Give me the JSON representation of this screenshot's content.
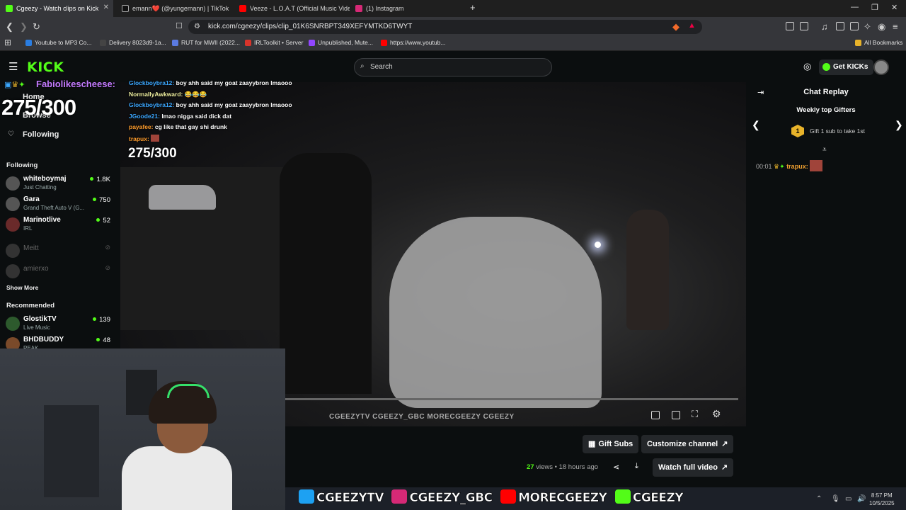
{
  "browser": {
    "tabs": [
      {
        "label": "Cgeezy - Watch clips on Kick",
        "color": "#53fc18",
        "active": true
      },
      {
        "label": "emann❤️ (@yungemann) | TikTok",
        "color": "#222222",
        "active": false
      },
      {
        "label": "Veeze - L.O.A.T (Official Music Video)",
        "color": "#ff0000",
        "active": false
      },
      {
        "label": "(1) Instagram",
        "color": "#d62976",
        "active": false
      }
    ],
    "new_tab": "+",
    "url": "kick.com/cgeezy/clips/clip_01K6SNRBPT349XEFYMTKD6TWYT",
    "bookmarks": [
      {
        "label": "Youtube to MP3 Co...",
        "color": "#2a7de1"
      },
      {
        "label": "Delivery 8023d9-1a...",
        "color": "#444444"
      },
      {
        "label": "RUT for MWII (2022...",
        "color": "#5a7ae0"
      },
      {
        "label": "IRLToolkit • Server",
        "color": "#d9342b"
      },
      {
        "label": "Unpublished, Mute...",
        "color": "#9146ff"
      },
      {
        "label": "https://www.youtub...",
        "color": "#ff0000"
      }
    ],
    "all_bookmarks": "All Bookmarks"
  },
  "kick": {
    "logo": "KICK",
    "search_placeholder": "Search",
    "get_kicks": "Get KICKs"
  },
  "sidebar": {
    "nav": [
      "Home",
      "Browse",
      "Following"
    ],
    "following_title": "Following",
    "following": [
      {
        "name": "whiteboymaj",
        "game": "Just Chatting",
        "viewers": "1.8K",
        "online": true
      },
      {
        "name": "Gara",
        "game": "Grand Theft Auto V (G...",
        "viewers": "750",
        "online": true
      },
      {
        "name": "Marinotlive",
        "game": "IRL",
        "viewers": "52",
        "online": true
      },
      {
        "name": "Meitt",
        "game": "",
        "viewers": "",
        "online": false
      },
      {
        "name": "amierxo",
        "game": "",
        "viewers": "",
        "online": false
      }
    ],
    "show_more": "Show More",
    "recommended_title": "Recommended",
    "recommended": [
      {
        "name": "GlostikTV",
        "game": "Live Music",
        "viewers": "139"
      },
      {
        "name": "BHDBUDDY",
        "game": "PEAK",
        "viewers": "48"
      }
    ]
  },
  "overlay": {
    "top_name": "Fabiolikescheese:",
    "big_count": "275/300",
    "small_count": "275/300",
    "chat": [
      {
        "user": "Glockboybra12:",
        "msg": "boy ahh said my goat zaayybron lmaooo",
        "cls": "u"
      },
      {
        "user": "NormallyAwkward:",
        "msg": "😂😂😂",
        "cls": "u2"
      },
      {
        "user": "Glockboybra12:",
        "msg": "boy ahh said my goat zaayybron lmaooo",
        "cls": "u"
      },
      {
        "user": "JGoode21:",
        "msg": "lmao nigga said dick dat",
        "cls": "u"
      },
      {
        "user": "payafee:",
        "msg": "cg like that gay shi drunk",
        "cls": "u3"
      },
      {
        "user": "trapux:",
        "msg": "",
        "cls": "u3"
      }
    ]
  },
  "video": {
    "watermark": "CGEEZYTV  CGEEZY_GBC  MORECGEEZY  CGEEZY",
    "progress": 1.0
  },
  "clip_info": {
    "gift_subs": "Gift Subs",
    "customize": "Customize channel",
    "views": "27",
    "views_label": "views",
    "age": "• 18 hours ago",
    "watch_full": "Watch full video"
  },
  "replay": {
    "title": "Chat Replay",
    "weekly": "Weekly top Gifters",
    "rank": "1",
    "gift_hint": "Gift 1 sub to take 1st",
    "line_time": "00:01",
    "line_user": "trapux:"
  },
  "stream_overlay": {
    "socials": [
      "CGEEZYTV",
      "CGEEZY_GBC",
      "MORECGEEZY",
      "CGEEZY"
    ],
    "social_colors": [
      "#1da1f2",
      "#d62976",
      "#ff0000",
      "#53fc18"
    ]
  },
  "taskbar": {
    "time": "8:57 PM",
    "date": "10/5/2025"
  }
}
